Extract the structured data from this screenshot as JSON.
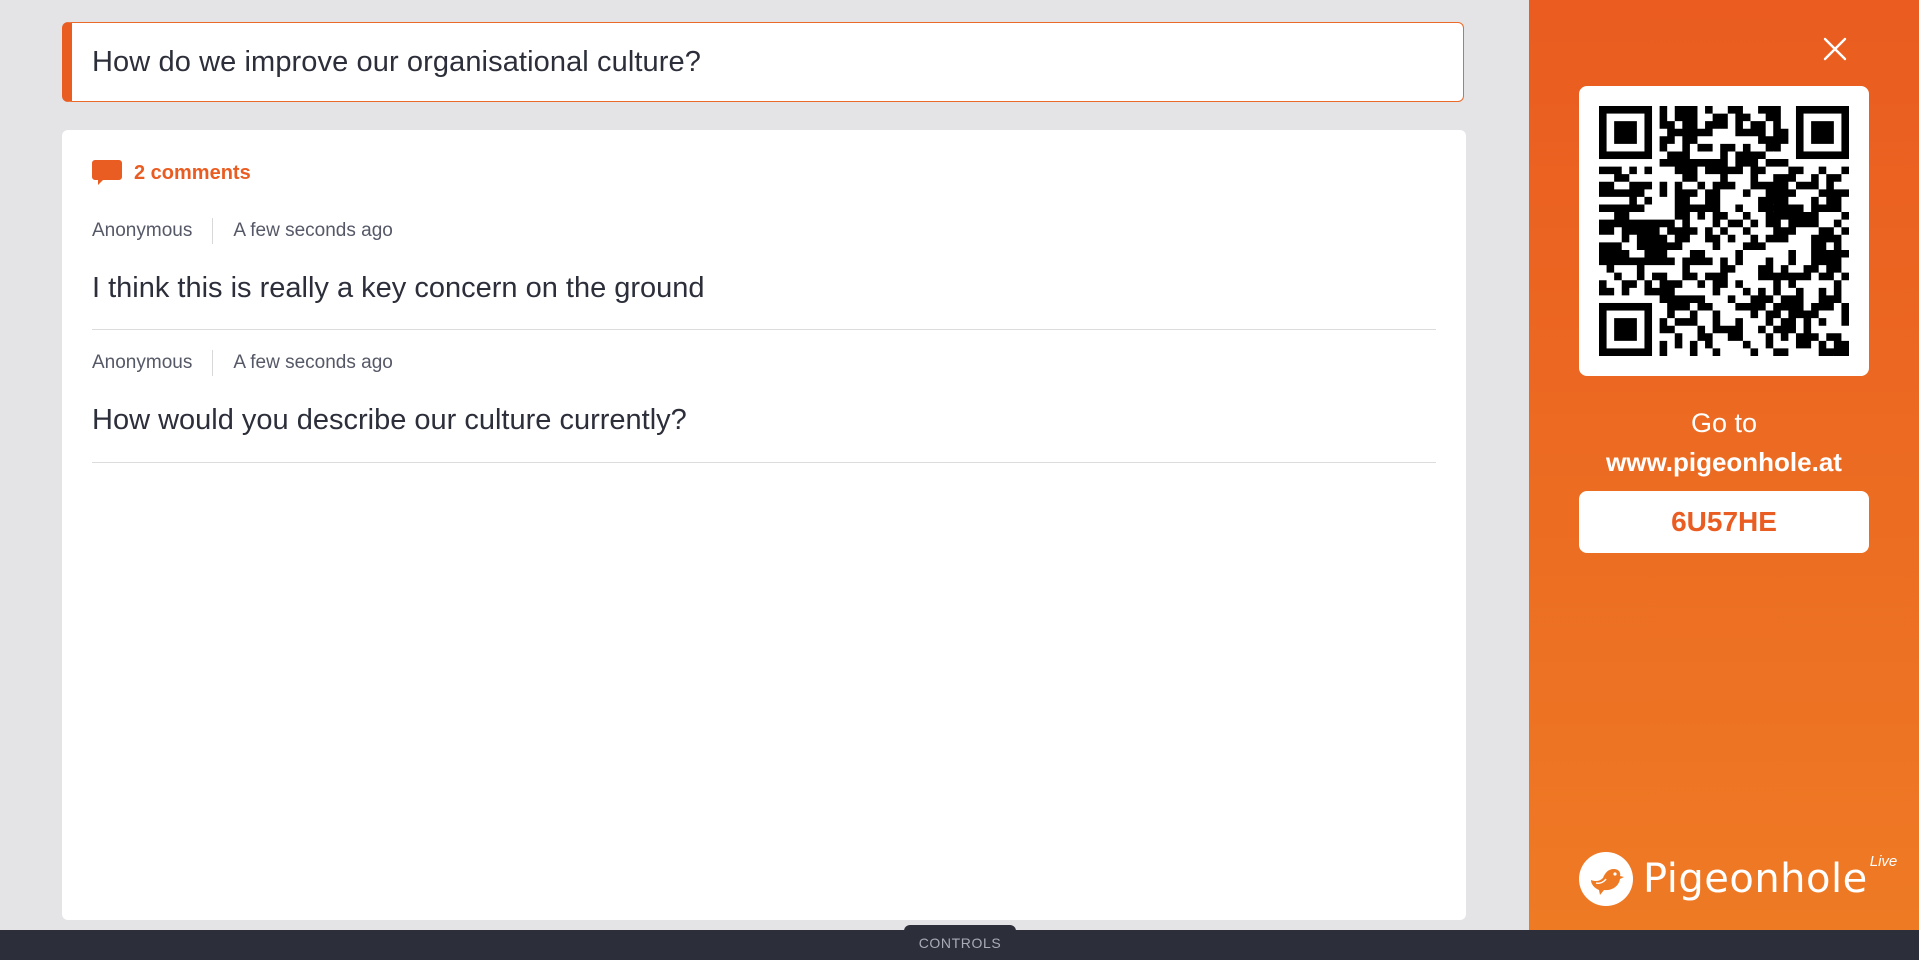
{
  "question": {
    "text": "How do we improve our organisational culture?"
  },
  "comments_header": {
    "icon": "comment-icon",
    "count_label": "2 comments"
  },
  "comments": [
    {
      "author": "Anonymous",
      "time": "A few seconds ago",
      "body": "I think this is really a key concern on the ground"
    },
    {
      "author": "Anonymous",
      "time": "A few seconds ago",
      "body": "How would you describe our culture currently?"
    }
  ],
  "sidebar": {
    "close_icon": "close-icon",
    "goto_label": "Go to",
    "url": "www.pigeonhole.at",
    "event_code": "6U57HE",
    "brand_name": "Pigeonhole",
    "brand_suffix": "Live"
  },
  "bottom_bar": {
    "controls_label": "CONTROLS"
  },
  "colors": {
    "accent": "#ea5d22",
    "dark": "#2c2e3a",
    "background": "#e4e4e7"
  }
}
